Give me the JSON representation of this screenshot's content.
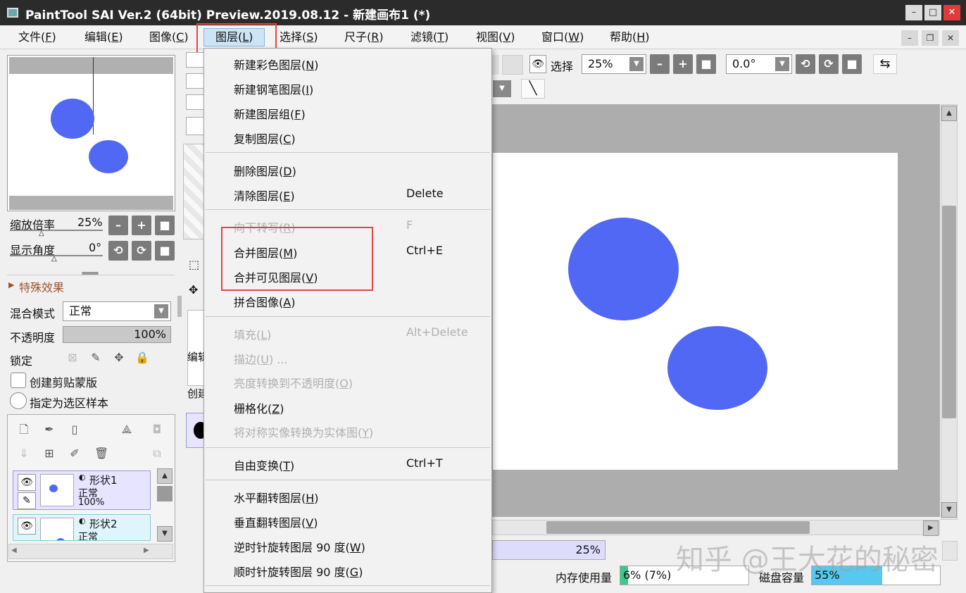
{
  "window": {
    "title": "PaintTool SAI Ver.2 (64bit) Preview.2019.08.12 - 新建画布1 (*)"
  },
  "menubar": {
    "items": [
      {
        "label": "文件(",
        "key": "F"
      },
      {
        "label": "编辑(",
        "key": "E"
      },
      {
        "label": "图像(",
        "key": "C"
      },
      {
        "label": "图层(",
        "key": "L"
      },
      {
        "label": "选择(",
        "key": "S"
      },
      {
        "label": "尺子(",
        "key": "R"
      },
      {
        "label": "滤镜(",
        "key": "T"
      },
      {
        "label": "视图(",
        "key": "V"
      },
      {
        "label": "窗口(",
        "key": "W"
      },
      {
        "label": "帮助(",
        "key": "H"
      }
    ],
    "close_paren": ")"
  },
  "layer_menu": {
    "items": [
      {
        "label": "新建彩色图层(",
        "key": "N",
        "tail": ")",
        "shortcut": "",
        "disabled": false
      },
      {
        "label": "新建钢笔图层(",
        "key": "I",
        "tail": ")",
        "shortcut": "",
        "disabled": false
      },
      {
        "label": "新建图层组(",
        "key": "F",
        "tail": ")",
        "shortcut": "",
        "disabled": false
      },
      {
        "label": "复制图层(",
        "key": "C",
        "tail": ")",
        "shortcut": "",
        "disabled": false
      },
      {
        "label": "删除图层(",
        "key": "D",
        "tail": ")",
        "shortcut": "",
        "disabled": false
      },
      {
        "label": "清除图层(",
        "key": "E",
        "tail": ")",
        "shortcut": "Delete",
        "disabled": false
      },
      {
        "label": "向下转写(",
        "key": "R",
        "tail": ")",
        "shortcut": "F",
        "disabled": true
      },
      {
        "label": "合并图层(",
        "key": "M",
        "tail": ")",
        "shortcut": "Ctrl+E",
        "disabled": false
      },
      {
        "label": "合并可见图层(",
        "key": "V",
        "tail": ")",
        "shortcut": "",
        "disabled": false
      },
      {
        "label": "拼合图像(",
        "key": "A",
        "tail": ")",
        "shortcut": "",
        "disabled": false
      },
      {
        "label": "填充(",
        "key": "L",
        "tail": ")",
        "shortcut": "Alt+Delete",
        "disabled": true
      },
      {
        "label": "描边(",
        "key": "U",
        "tail": ") ...",
        "shortcut": "",
        "disabled": true
      },
      {
        "label": "亮度转换到不透明度(",
        "key": "O",
        "tail": ")",
        "shortcut": "",
        "disabled": true
      },
      {
        "label": "栅格化(",
        "key": "Z",
        "tail": ")",
        "shortcut": "",
        "disabled": false
      },
      {
        "label": "将对称实像转换为实体图(",
        "key": "Y",
        "tail": ")",
        "shortcut": "",
        "disabled": true
      },
      {
        "label": "自由变换(",
        "key": "T",
        "tail": ")",
        "shortcut": "Ctrl+T",
        "disabled": false
      },
      {
        "label": "水平翻转图层(",
        "key": "H",
        "tail": ")",
        "shortcut": "",
        "disabled": false
      },
      {
        "label": "垂直翻转图层(",
        "key": "V",
        "tail": ")",
        "shortcut": "",
        "disabled": false
      },
      {
        "label": "逆时针旋转图层 90 度(",
        "key": "W",
        "tail": ")",
        "shortcut": "",
        "disabled": false
      },
      {
        "label": "顺时针旋转图层 90 度(",
        "key": "G",
        "tail": ")",
        "shortcut": "",
        "disabled": false
      }
    ]
  },
  "navigator": {
    "zoom_label": "缩放倍率",
    "zoom_value": "25%",
    "angle_label": "显示角度",
    "angle_value": "0°"
  },
  "effects": {
    "label": "特殊效果"
  },
  "layer_props": {
    "blend_label": "混合模式",
    "blend_value": "正常",
    "opacity_label": "不透明度",
    "opacity_value": "100%",
    "opacity_fraction": 1.0,
    "lock_label": "锁定",
    "clip_label": "创建剪贴蒙版",
    "sample_label": "指定为选区样本"
  },
  "layers": [
    {
      "name": "形状1",
      "mode": "正常",
      "opacity": "100%"
    },
    {
      "name": "形状2",
      "mode": "正常"
    }
  ],
  "mid_panel": {
    "label_a": "编辑",
    "label_b": "创建"
  },
  "toolbar": {
    "select_label": "选择",
    "zoom_value": "25%",
    "angle_value": "0.0°"
  },
  "status": {
    "progress_value": "25%",
    "memory_label": "内存使用量",
    "memory_value": "6% (7%)",
    "memory_fraction": 0.06,
    "disk_label": "磁盘容量",
    "disk_value": "55%",
    "disk_fraction": 0.55
  },
  "watermark": "知乎 @王大花的秘密",
  "colors": {
    "shape_blue": "#5168f5",
    "highlight_red": "#e54444",
    "memory_green": "#3cc88c",
    "disk_blue": "#58c8f0"
  }
}
